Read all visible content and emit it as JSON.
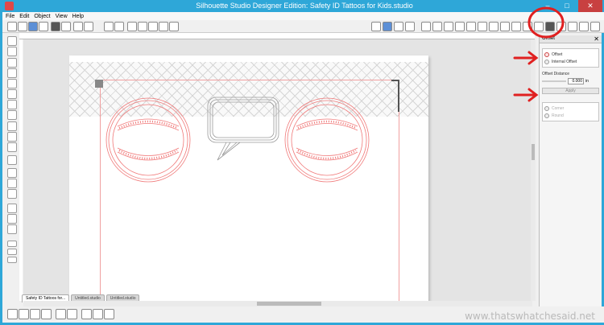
{
  "window": {
    "title": "Silhouette Studio Designer Edition: Safety ID Tattoos for Kids.studio",
    "minimize": "–",
    "maximize": "□",
    "close": "✕"
  },
  "menu": [
    "File",
    "Edit",
    "Object",
    "View",
    "Help"
  ],
  "tabs": [
    "Safety ID Tattoos for...",
    "Untitled.studio",
    "Untitled.studio"
  ],
  "offset_panel": {
    "title": "Offset",
    "close": "✕",
    "options": [
      "Offset",
      "Internal Offset"
    ],
    "distance_label": "Offset Distance",
    "distance_value": "0.000",
    "distance_unit": "in",
    "apply_label": "Apply",
    "corner_options": [
      "Corner",
      "Round"
    ]
  },
  "watermark": "www.thatswhatchesaid.net",
  "colors": {
    "titlebar": "#2ea7d8",
    "cut_line": "#f0a0a0",
    "annotation": "#e02020"
  },
  "icons": {
    "arrow": "arrow-icon"
  }
}
